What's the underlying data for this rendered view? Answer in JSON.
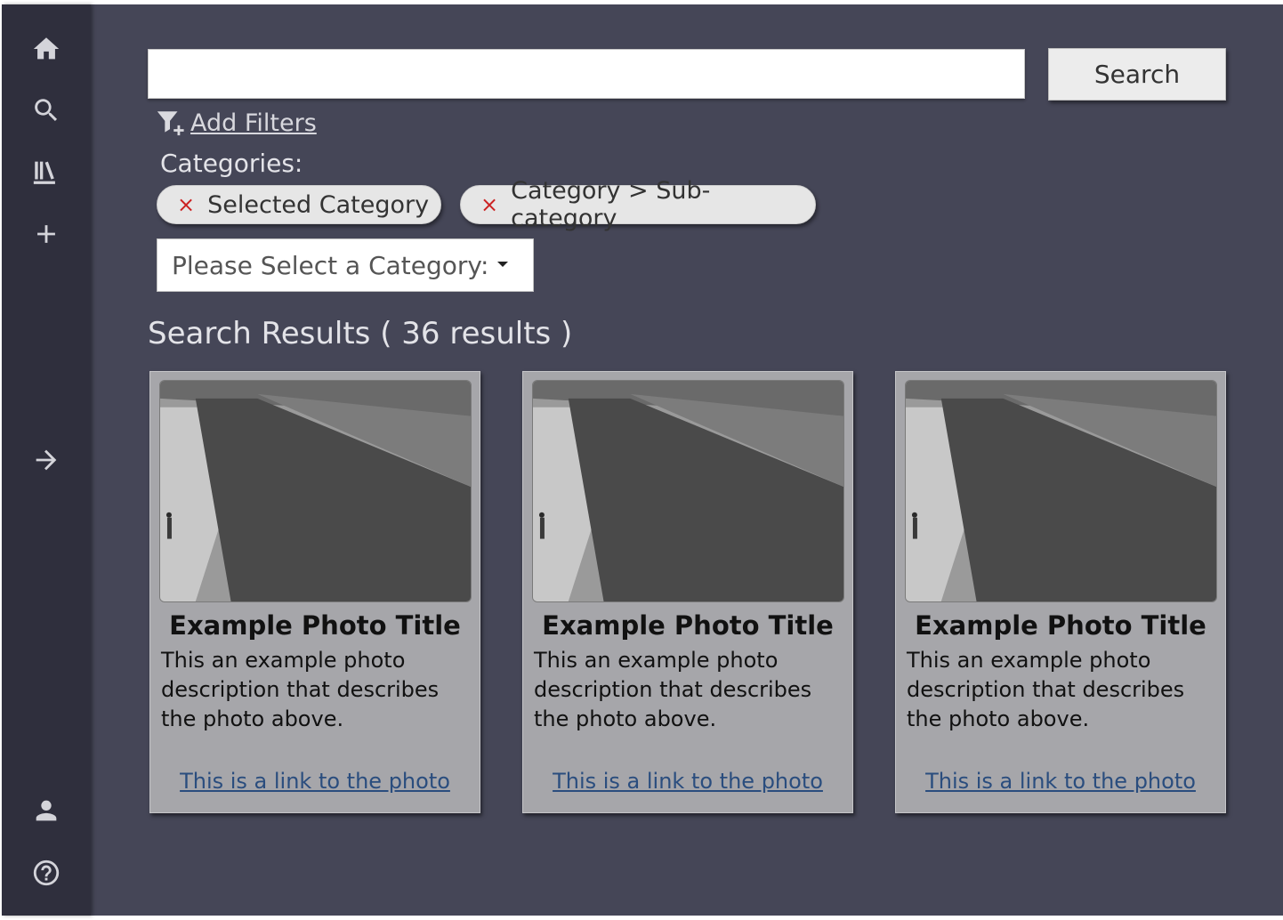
{
  "sidebar": {
    "items": [
      {
        "icon": "home-icon"
      },
      {
        "icon": "search-icon"
      },
      {
        "icon": "library-icon"
      },
      {
        "icon": "add-icon"
      },
      {
        "icon": "arrow-right-icon"
      },
      {
        "icon": "user-icon"
      },
      {
        "icon": "help-icon"
      }
    ]
  },
  "search": {
    "value": "",
    "placeholder": "",
    "button_label": "Search"
  },
  "filters": {
    "link_label": "Add Filters",
    "categories_label": "Categories:",
    "chips": [
      {
        "remove_glyph": "×",
        "label": "Selected Category"
      },
      {
        "remove_glyph": "×",
        "label": "Category > Sub-category"
      }
    ],
    "select_label": "Please Select a Category:"
  },
  "results": {
    "heading": "Search Results ( 36 results )",
    "cards": [
      {
        "title": "Example Photo Title",
        "description": "This an example photo description that describes the photo above.",
        "link": "This is a link to the photo"
      },
      {
        "title": "Example Photo Title",
        "description": "This an example photo description that describes the photo above.",
        "link": "This is a link to the photo"
      },
      {
        "title": "Example Photo Title",
        "description": "This an example photo description that describes the photo above.",
        "link": "This is a link to the photo"
      }
    ]
  },
  "colors": {
    "background": "#454657",
    "sidebar": "#2f2f3d",
    "card": "#a6a6aa",
    "link": "#2a4d7e",
    "chip_remove": "#cc2222"
  }
}
